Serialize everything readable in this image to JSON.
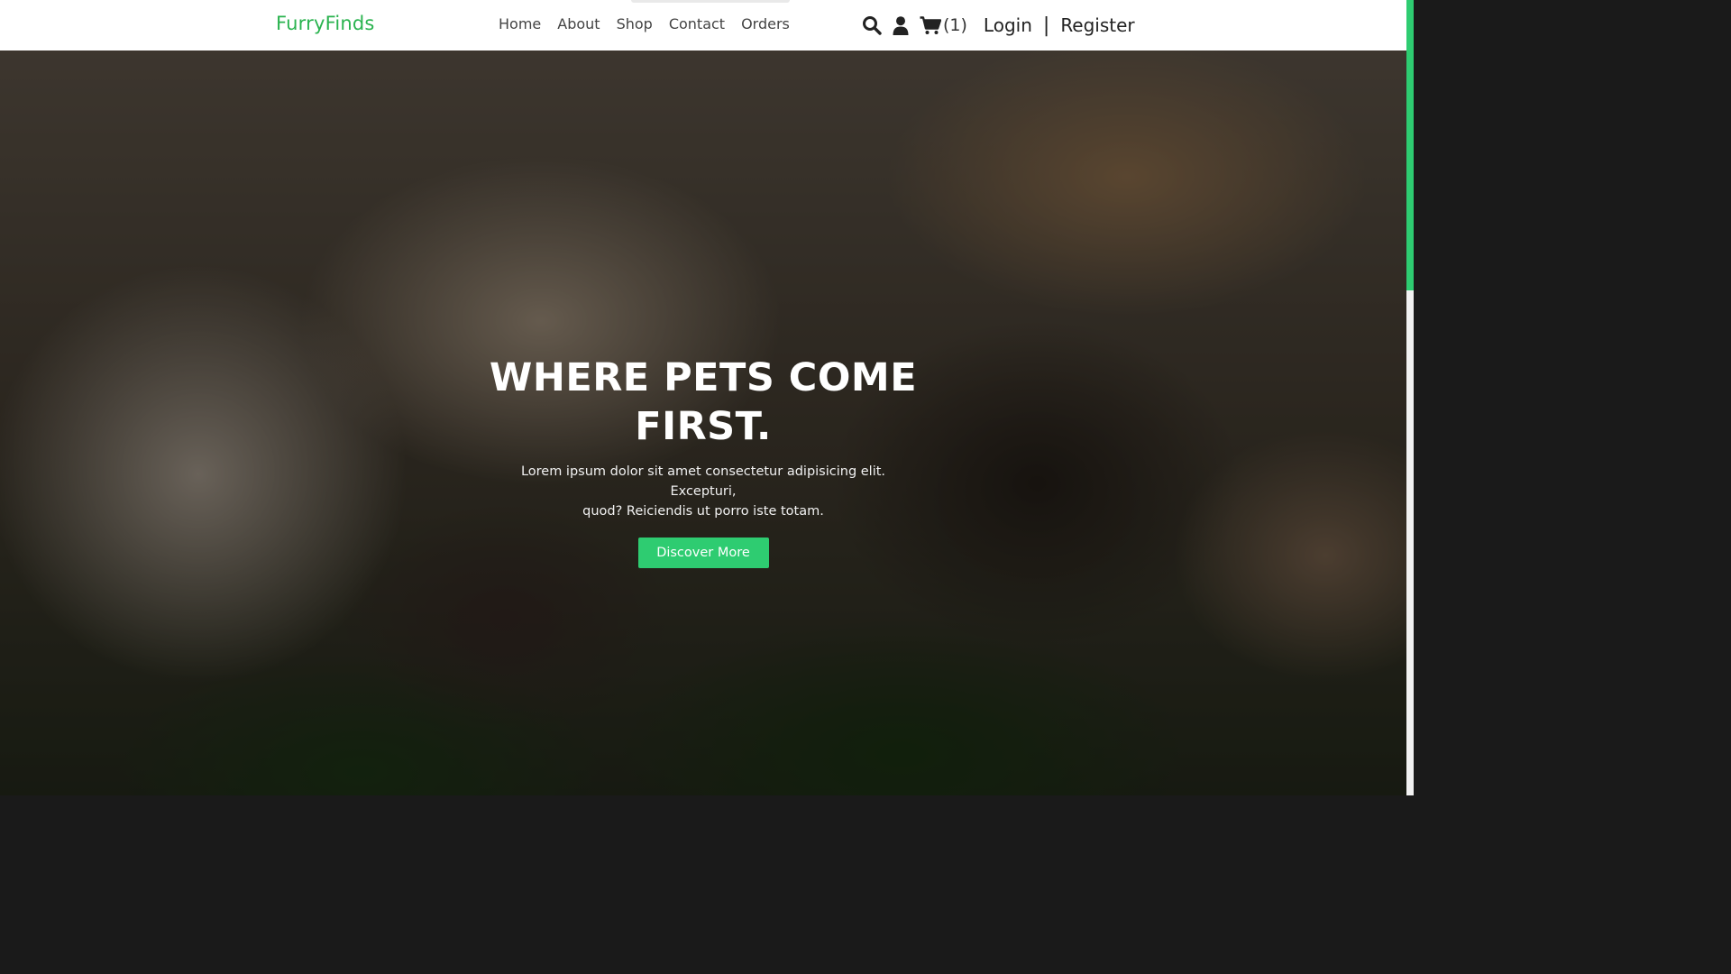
{
  "header": {
    "brand": "FurryFinds",
    "nav": [
      "Home",
      "About",
      "Shop",
      "Contact",
      "Orders"
    ],
    "icons": [
      "search-icon",
      "user-icon",
      "cart-icon"
    ],
    "cart_count": "(1)",
    "login": "Login",
    "separator": "|",
    "register": "Register"
  },
  "hero": {
    "title_line1": "WHERE PETS COME",
    "title_line2": "FIRST.",
    "text_line1": "Lorem ipsum dolor sit amet consectetur adipisicing elit. Excepturi,",
    "text_line2": "quod? Reiciendis ut porro iste totam.",
    "button": "Discover More"
  },
  "colors": {
    "brand": "#2ab34f",
    "accent": "#2ecc71",
    "header_bg": "#ffffff"
  }
}
